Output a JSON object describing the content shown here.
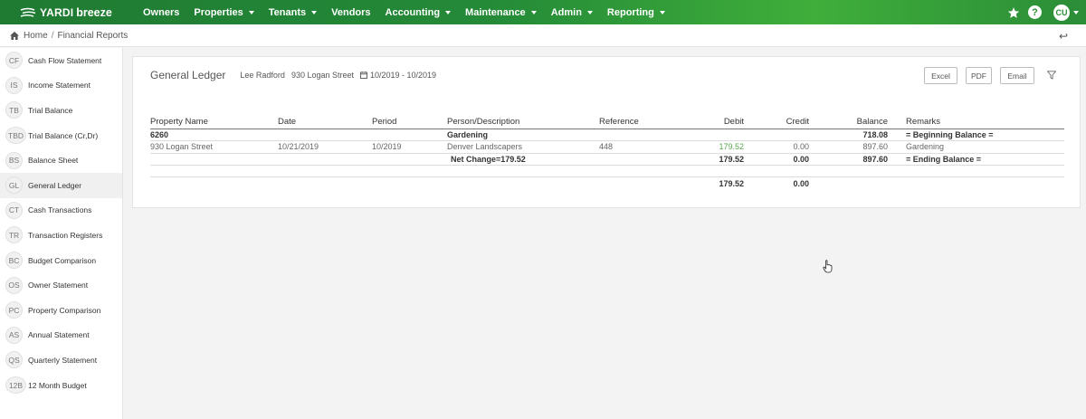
{
  "brand": {
    "yardi": "YARDI",
    "breeze": "breeze"
  },
  "nav": [
    {
      "label": "Owners",
      "caret": false
    },
    {
      "label": "Properties",
      "caret": true
    },
    {
      "label": "Tenants",
      "caret": true
    },
    {
      "label": "Vendors",
      "caret": false
    },
    {
      "label": "Accounting",
      "caret": true
    },
    {
      "label": "Maintenance",
      "caret": true
    },
    {
      "label": "Admin",
      "caret": true
    },
    {
      "label": "Reporting",
      "caret": true
    }
  ],
  "user": {
    "initials": "CU",
    "help": "?"
  },
  "breadcrumb": {
    "home": "Home",
    "sep": "/",
    "current": "Financial Reports",
    "back": "↩"
  },
  "sidebar": [
    {
      "badge": "CF",
      "label": "Cash Flow Statement"
    },
    {
      "badge": "IS",
      "label": "Income Statement"
    },
    {
      "badge": "TB",
      "label": "Trial Balance"
    },
    {
      "badge": "TBD",
      "label": "Trial Balance (Cr,Dr)"
    },
    {
      "badge": "BS",
      "label": "Balance Sheet"
    },
    {
      "badge": "GL",
      "label": "General Ledger",
      "active": true
    },
    {
      "badge": "CT",
      "label": "Cash Transactions"
    },
    {
      "badge": "TR",
      "label": "Transaction Registers"
    },
    {
      "badge": "BC",
      "label": "Budget Comparison"
    },
    {
      "badge": "OS",
      "label": "Owner Statement"
    },
    {
      "badge": "PC",
      "label": "Property Comparison"
    },
    {
      "badge": "AS",
      "label": "Annual Statement"
    },
    {
      "badge": "QS",
      "label": "Quarterly Statement"
    },
    {
      "badge": "12B",
      "label": "12 Month Budget"
    }
  ],
  "report": {
    "title": "General Ledger",
    "owner": "Lee Radford",
    "property": "930 Logan Street",
    "range": "10/2019 - 10/2019",
    "buttons": {
      "excel": "Excel",
      "pdf": "PDF",
      "email": "Email"
    }
  },
  "table": {
    "headers": {
      "property": "Property Name",
      "date": "Date",
      "period": "Period",
      "person": "Person/Description",
      "reference": "Reference",
      "debit": "Debit",
      "credit": "Credit",
      "balance": "Balance",
      "remarks": "Remarks"
    },
    "account_row": {
      "property": "6260",
      "person": "Gardening",
      "balance": "718.08",
      "remarks": "= Beginning Balance ="
    },
    "detail_row": {
      "property": "930 Logan Street",
      "date": "10/21/2019",
      "period": "10/2019",
      "person": "Denver Landscapers",
      "reference": "448",
      "debit": "179.52",
      "credit": "0.00",
      "balance": "897.60",
      "remarks": "Gardening"
    },
    "net_row": {
      "person": "Net Change=179.52",
      "debit": "179.52",
      "credit": "0.00",
      "balance": "897.60",
      "remarks": "= Ending Balance ="
    },
    "total_row": {
      "debit": "179.52",
      "credit": "0.00"
    }
  }
}
